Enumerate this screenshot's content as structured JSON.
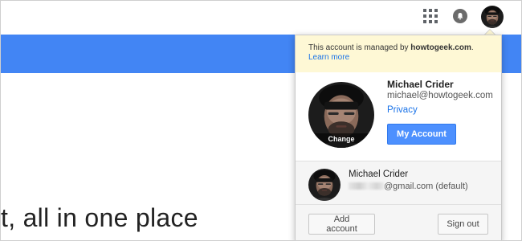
{
  "header": {
    "icons": [
      "apps-grid-icon",
      "notifications-bell-icon"
    ],
    "avatar_icon": "profile-avatar"
  },
  "background": {
    "headline": "t, all in one place",
    "band_color": "#4285f4"
  },
  "account_card": {
    "notice": {
      "prefix": "This account is managed by ",
      "domain": "howtogeek.com",
      "suffix": ".",
      "learn_more": "Learn more"
    },
    "profile": {
      "name": "Michael Crider",
      "email": "michael@howtogeek.com",
      "privacy": "Privacy",
      "change_photo": "Change",
      "my_account": "My Account"
    },
    "other_account": {
      "name": "Michael Crider",
      "email_suffix": "@gmail.com (default)"
    },
    "footer": {
      "add_account": "Add account",
      "sign_out": "Sign out"
    }
  },
  "colors": {
    "accent": "#4d90fe",
    "link": "#1a73e8",
    "notice_bg": "#fef8d5"
  }
}
